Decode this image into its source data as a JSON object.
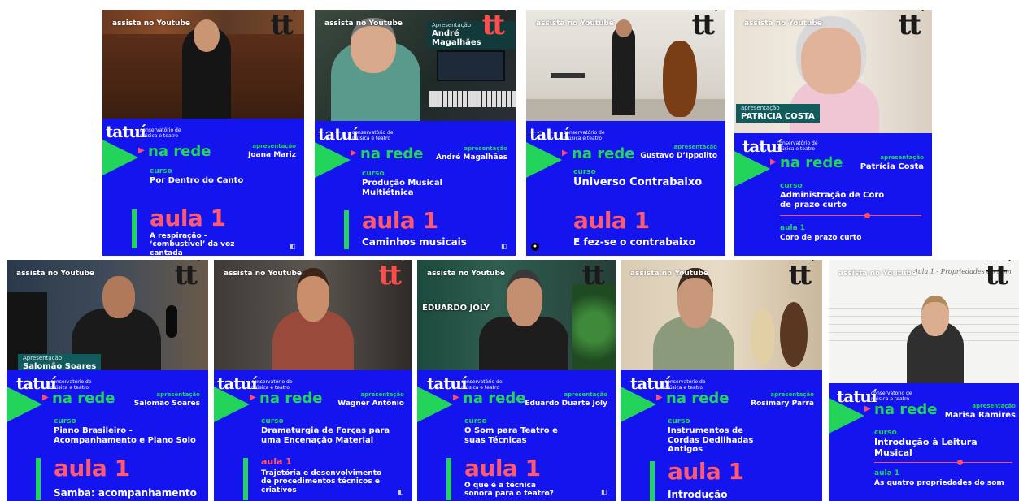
{
  "common": {
    "youtube": "assista no Youtube",
    "tt": "tt",
    "tatui": "tatuí",
    "brand_sub": "conservatório de música e teatro",
    "na_rede": "na rede",
    "apresentacao": "apresentação",
    "curso": "curso",
    "aula": "aula 1"
  },
  "cards": [
    {
      "apresentador": "Joana Mariz",
      "curso": "Por Dentro do Canto",
      "aula_titulo": "A respiração - ‘combustível’ da voz cantada"
    },
    {
      "apresentador": "André Magalhães",
      "tag": "André Magalhães",
      "tag_label": "Apresentação",
      "curso": "Produção Musical Multiétnica",
      "aula_titulo": "Caminhos musicais"
    },
    {
      "apresentador": "Gustavo D’Ippolito",
      "curso": "Universo Contrabaixo",
      "aula_titulo": "E fez-se o contrabaixo"
    },
    {
      "apresentador": "Patrícia Costa",
      "tag": "PATRICIA COSTA",
      "tag_label": "apresentação",
      "curso": "Administração de Coro de prazo curto",
      "aula_label": "aula 1",
      "aula_titulo": "Coro de prazo curto"
    },
    {
      "apresentador": "Salomão Soares",
      "tag": "Salomão Soares",
      "tag_label": "Apresentação",
      "curso": "Piano Brasileiro - Acompanhamento e Piano Solo",
      "aula_titulo": "Samba: acompanhamento"
    },
    {
      "apresentador": "Wagner Antônio",
      "curso": "Dramaturgia de Forças para uma Encenação Material",
      "aula_label": "aula 1",
      "aula_titulo": "Trajetória e desenvolvimento de procedimentos técnicos e criativos"
    },
    {
      "apresentador": "Eduardo Duarte Joly",
      "tag": "EDUARDO JOLY",
      "curso": "O Som para Teatro e suas Técnicas",
      "aula_titulo": "O que é a técnica sonora para o teatro?"
    },
    {
      "apresentador": "Rosimary Parra",
      "curso": "Instrumentos de Cordas Dedilhadas Antigos",
      "aula_titulo": "Introdução"
    },
    {
      "apresentador": "Marisa Ramires",
      "whiteboard": "Aula 1 - Propriedades do Som",
      "curso": "Introdução à Leitura Musical",
      "aula_label": "aula 1",
      "aula_titulo": "As quatro propriedades do som"
    }
  ],
  "colors": {
    "blue": "#1414ee",
    "green": "#22d45a",
    "coral": "#ff5a6e",
    "teal": "#125b5d"
  }
}
